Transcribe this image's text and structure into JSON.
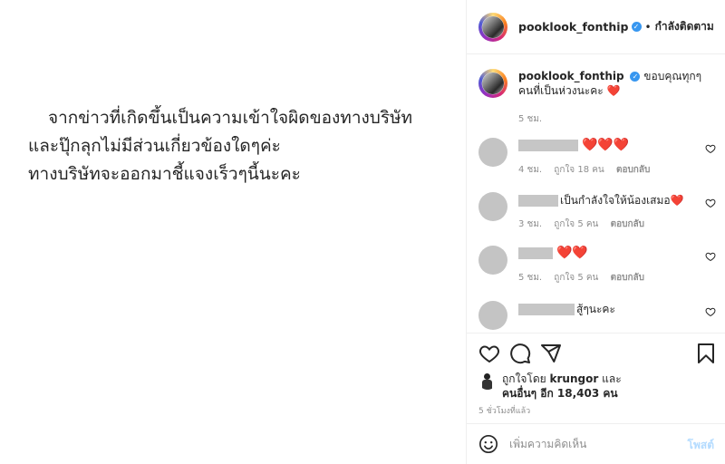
{
  "post": {
    "lines": [
      "จากข่าวที่เกิดขึ้นเป็นความเข้าใจผิดของทางบริษัท",
      "และปุ๊กลุกไม่มีส่วนเกี่ยวข้องใดๆค่ะ",
      "ทางบริษัทจะออกมาชี้แจงเร็วๆนี้นะคะ"
    ]
  },
  "header": {
    "username": "pooklook_fonthip",
    "verified_icon": "verified-badge-icon",
    "separator": "•",
    "follow_label": "กำลังติดตาม"
  },
  "caption": {
    "username": "pooklook_fonthip",
    "text": "ขอบคุณทุกๆคนที่เป็นห่วงนะคะ ❤️",
    "time": "5 ชม."
  },
  "comments": [
    {
      "text": "❤️❤️❤️",
      "time": "4 ชม.",
      "likes": "ถูกใจ 18 คน",
      "reply": "ตอบกลับ"
    },
    {
      "text": "เป็นกำลังใจให้น้องเสมอ❤️",
      "time": "3 ชม.",
      "likes": "ถูกใจ 5 คน",
      "reply": "ตอบกลับ"
    },
    {
      "text": "❤️❤️",
      "time": "5 ชม.",
      "likes": "ถูกใจ 5 คน",
      "reply": "ตอบกลับ"
    },
    {
      "text": "สู้ๆนะคะ",
      "time": "",
      "likes": "",
      "reply": ""
    }
  ],
  "actions": {
    "icons": [
      "heart-icon",
      "comment-icon",
      "share-icon",
      "bookmark-icon"
    ]
  },
  "likes": {
    "prefix": "ถูกใจโดย",
    "user": "krungor",
    "and": "และ",
    "others": "คนอื่นๆ อีก 18,403 คน"
  },
  "timestamp": "5 ชั่วโมงที่แล้ว",
  "add_comment": {
    "placeholder": "เพิ่มความคิดเห็น",
    "post_label": "โพสต์"
  },
  "colors": {
    "verified": "#3897f0",
    "heart": "#e0202e",
    "post_button": "#b3dbff",
    "muted": "#8e8e8e"
  }
}
